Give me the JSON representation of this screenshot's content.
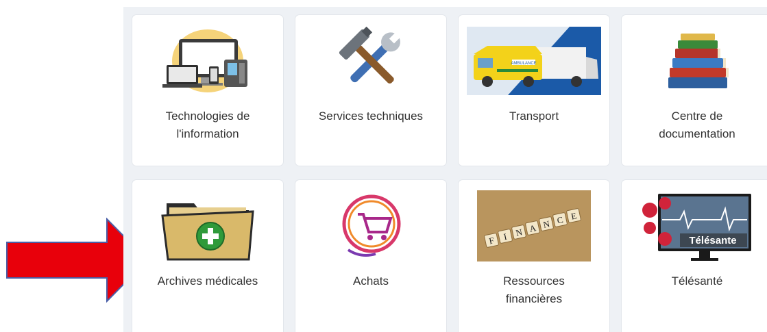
{
  "tiles": [
    {
      "label": "Technologies de\nl'information",
      "icon": "computer-devices-icon"
    },
    {
      "label": "Services techniques",
      "icon": "wrench-hammer-icon"
    },
    {
      "label": "Transport",
      "icon": "ambulance-icon"
    },
    {
      "label": "Centre de\ndocumentation",
      "icon": "books-stack-icon"
    },
    {
      "label": "Archives médicales",
      "icon": "folder-add-icon"
    },
    {
      "label": "Achats",
      "icon": "shopping-cart-icon"
    },
    {
      "label": "Ressources\nfinancières",
      "icon": "finance-tiles-icon"
    },
    {
      "label": "Télésanté",
      "icon": "telehealth-monitor-icon"
    }
  ],
  "telehealth_banner": "Télésante",
  "finance_letters": [
    "F",
    "I",
    "N",
    "A",
    "N",
    "C",
    "E"
  ],
  "ambulance_text": "AMBULANCE",
  "colors": {
    "panel": "#eef1f5",
    "arrow": "#e8000b",
    "label": "#333333"
  }
}
